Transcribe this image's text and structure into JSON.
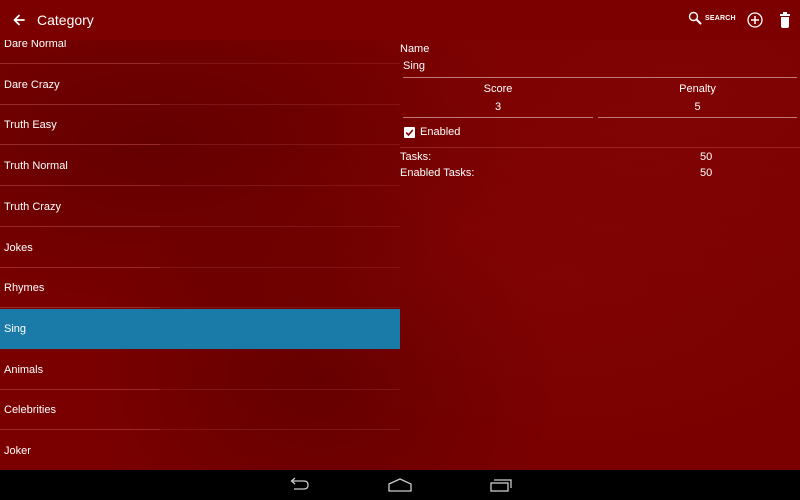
{
  "actionbar": {
    "title": "Category",
    "search_label": "SEARCH",
    "icons": {
      "back": "arrow-left-icon",
      "search": "search-icon",
      "add": "add-circle-icon",
      "delete": "trash-icon"
    }
  },
  "categories": [
    {
      "label": "Dare Normal",
      "selected": false
    },
    {
      "label": "Dare Crazy",
      "selected": false
    },
    {
      "label": "Truth Easy",
      "selected": false
    },
    {
      "label": "Truth Normal",
      "selected": false
    },
    {
      "label": "Truth Crazy",
      "selected": false
    },
    {
      "label": "Jokes",
      "selected": false
    },
    {
      "label": "Rhymes",
      "selected": false
    },
    {
      "label": "Sing",
      "selected": true
    },
    {
      "label": "Animals",
      "selected": false
    },
    {
      "label": "Celebrities",
      "selected": false
    },
    {
      "label": "Joker",
      "selected": false
    }
  ],
  "detail": {
    "name_label": "Name",
    "name_value": "Sing",
    "score_label": "Score",
    "score_value": "3",
    "penalty_label": "Penalty",
    "penalty_value": "5",
    "enabled_label": "Enabled",
    "enabled_checked": true,
    "tasks_label": "Tasks:",
    "tasks_value": "50",
    "enabled_tasks_label": "Enabled Tasks:",
    "enabled_tasks_value": "50"
  },
  "colors": {
    "background": "#7a0000",
    "selected": "#1a7aa8",
    "navbar": "#000000"
  },
  "navbar": {
    "icons": [
      "back-nav-icon",
      "home-nav-icon",
      "recents-nav-icon"
    ]
  }
}
